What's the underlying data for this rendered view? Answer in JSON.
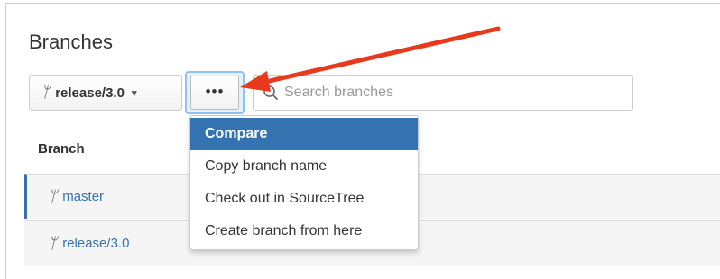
{
  "page": {
    "title": "Branches"
  },
  "toolbar": {
    "branch_selector": {
      "value": "release/3.0",
      "icon": "branch-icon",
      "caret": "▾"
    },
    "more_button_label": "•••",
    "search": {
      "placeholder": "Search branches",
      "value": "",
      "icon": "search-icon"
    }
  },
  "table": {
    "column_header": "Branch",
    "rows": [
      {
        "name": "master",
        "icon": "branch-icon"
      },
      {
        "name": "release/3.0",
        "icon": "branch-icon"
      }
    ]
  },
  "dropdown": {
    "items": [
      {
        "label": "Compare",
        "active": true
      },
      {
        "label": "Copy branch name",
        "active": false
      },
      {
        "label": "Check out in SourceTree",
        "active": false
      },
      {
        "label": "Create branch from here",
        "active": false
      }
    ]
  },
  "colors": {
    "accent": "#3572b0",
    "arrow": "#e8391d",
    "focus_ring": "#8fc3f2"
  }
}
